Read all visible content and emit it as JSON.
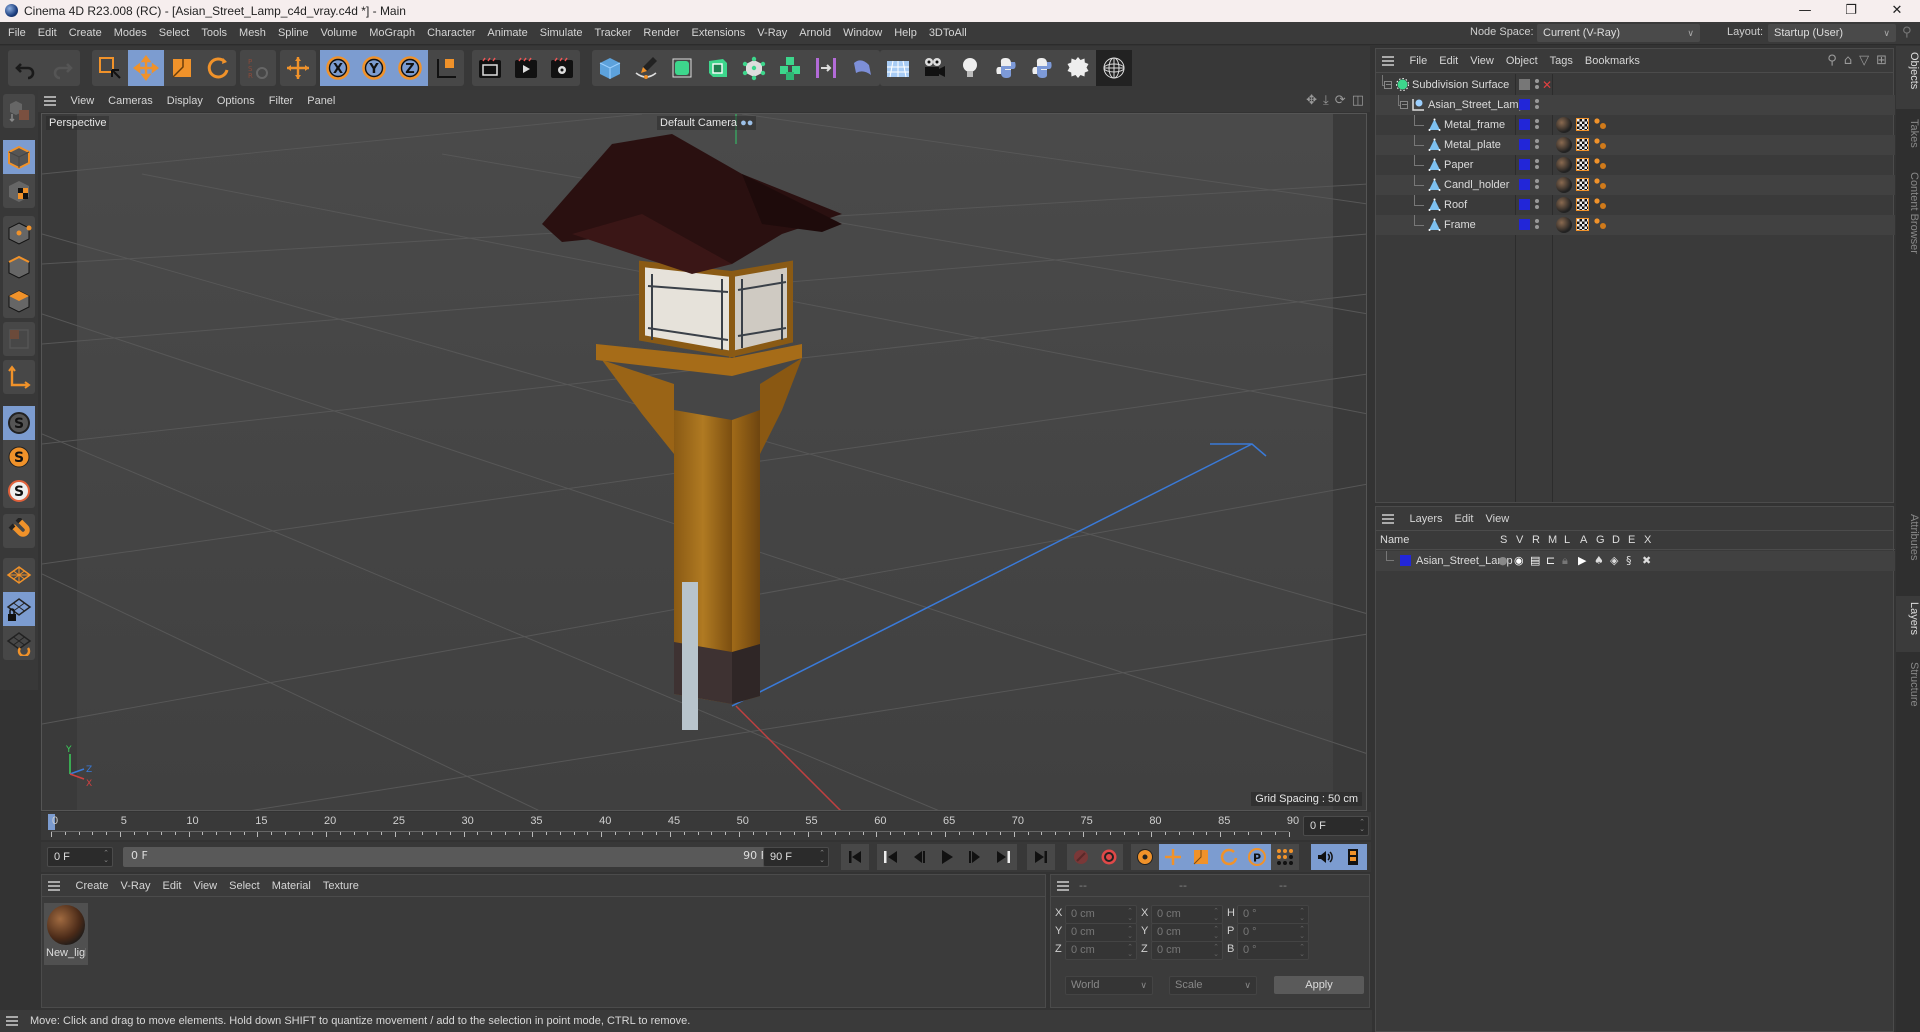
{
  "window": {
    "title": "Cinema 4D R23.008 (RC) - [Asian_Street_Lamp_c4d_vray.c4d *] - Main",
    "controls": [
      "minimize",
      "maximize",
      "close"
    ]
  },
  "menubar": {
    "items": [
      "File",
      "Edit",
      "Create",
      "Modes",
      "Select",
      "Tools",
      "Mesh",
      "Spline",
      "Volume",
      "MoGraph",
      "Character",
      "Animate",
      "Simulate",
      "Tracker",
      "Render",
      "Extensions",
      "V-Ray",
      "Arnold",
      "Window",
      "Help",
      "3DToAll"
    ],
    "node_space_label": "Node Space:",
    "node_space_value": "Current (V-Ray)",
    "layout_label": "Layout:",
    "layout_value": "Startup (User)"
  },
  "toolbar": {
    "groups": [
      [
        "undo-icon",
        "redo-icon"
      ],
      [
        "live-selection-icon",
        "move-icon",
        "scale-icon",
        "rotate-icon"
      ],
      [
        "psr-icon"
      ],
      [
        "world-axis-move-icon"
      ],
      [
        "x-axis-lock-icon",
        "y-axis-lock-icon",
        "z-axis-lock-icon",
        "coordinate-system-icon"
      ],
      [
        "render-view-icon",
        "render-picture-viewer-icon",
        "render-settings-icon"
      ],
      [
        "cube-icon",
        "pen-icon",
        "subdivision-icon",
        "extrude-icon",
        "cloner-icon",
        "mograph-array-icon",
        "symmetry-icon",
        "deformer-bend-icon"
      ],
      [
        "floor-icon",
        "camera-icon",
        "light-icon",
        "python-icon",
        "python-script-icon",
        "gear-badge-icon",
        "sphere-wire-icon"
      ]
    ],
    "active": [
      "move-icon",
      "x-axis-lock-icon",
      "y-axis-lock-icon",
      "z-axis-lock-icon"
    ]
  },
  "left_tools": {
    "items": [
      "make-editable-icon",
      "model-mode-icon",
      "texture-mode-icon",
      "point-mode-icon",
      "edge-mode-icon",
      "polygon-mode-icon",
      "uv-mode-icon",
      "axis-mode-icon",
      "solo-off-icon",
      "solo-single-icon",
      "solo-hierarchy-icon",
      "snap-icon",
      "workplane-icon",
      "workplane-lock-icon",
      "workplane-align-icon"
    ],
    "active": [
      "model-mode-icon",
      "solo-off-icon",
      "workplane-lock-icon"
    ]
  },
  "viewport": {
    "menu": [
      "View",
      "Cameras",
      "Display",
      "Options",
      "Filter",
      "Panel"
    ],
    "view_name": "Perspective",
    "camera_name": "Default Camera",
    "grid_spacing": "Grid Spacing : 50 cm",
    "nav_icons": [
      "move-view-icon",
      "zoom-view-icon",
      "rotate-view-icon",
      "maximize-view-icon"
    ],
    "axis_labels": {
      "x": "X",
      "y": "Y",
      "z": "Z"
    }
  },
  "timeline": {
    "labels": [
      0,
      5,
      10,
      15,
      20,
      25,
      30,
      35,
      40,
      45,
      50,
      55,
      60,
      65,
      70,
      75,
      80,
      85,
      90
    ],
    "current_frame_display": "0 F",
    "start_field": "0 F",
    "range_start": "0 F",
    "range_end": "90 F",
    "end_field": "90 F",
    "playhead_frame": 0,
    "max_frame": 90
  },
  "playback": {
    "buttons": [
      "go-to-start-icon",
      "previous-key-icon",
      "previous-frame-icon",
      "play-icon",
      "next-frame-icon",
      "next-key-icon",
      "go-to-end-icon",
      "record-disabled-icon",
      "autokey-icon",
      "keyframe-settings-icon",
      "key-position-icon",
      "key-scale-icon",
      "key-rotation-icon",
      "key-parameter-icon",
      "key-pla-icon",
      "sound-icon",
      "timeline-film-icon"
    ],
    "active": [
      "key-position-icon",
      "key-scale-icon",
      "key-rotation-icon",
      "key-parameter-icon",
      "sound-icon",
      "timeline-film-icon"
    ]
  },
  "material_manager": {
    "menu": [
      "Create",
      "V-Ray",
      "Edit",
      "View",
      "Select",
      "Material",
      "Texture"
    ],
    "materials": [
      {
        "name": "New_ligl"
      }
    ]
  },
  "coordinates": {
    "headers": [
      "--",
      "--",
      "--"
    ],
    "rows": [
      {
        "a": "X",
        "a_val": "0 cm",
        "b": "X",
        "b_val": "0 cm",
        "c": "H",
        "c_val": "0 °"
      },
      {
        "a": "Y",
        "a_val": "0 cm",
        "b": "Y",
        "b_val": "0 cm",
        "c": "P",
        "c_val": "0 °"
      },
      {
        "a": "Z",
        "a_val": "0 cm",
        "b": "Z",
        "b_val": "0 cm",
        "c": "B",
        "c_val": "0 °"
      }
    ],
    "space": "World",
    "mode": "Scale",
    "apply_label": "Apply"
  },
  "status": {
    "text": "Move: Click and drag to move elements. Hold down SHIFT to quantize movement / add to the selection in point mode, CTRL to remove."
  },
  "object_manager": {
    "menu": [
      "File",
      "Edit",
      "View",
      "Object",
      "Tags",
      "Bookmarks"
    ],
    "tools": [
      "search-icon",
      "home-icon",
      "filter-icon",
      "new-window-icon"
    ],
    "objects": [
      {
        "name": "Subdivision Surface",
        "level": 0,
        "type": "subdivision",
        "color": "#2226d8",
        "tags": false
      },
      {
        "name": "Asian_Street_Lamp",
        "level": 1,
        "type": "null",
        "color": "#2226d8",
        "tags": false
      },
      {
        "name": "Metal_frame",
        "level": 2,
        "type": "polygon",
        "color": "#2226d8",
        "tags": true
      },
      {
        "name": "Metal_plate",
        "level": 2,
        "type": "polygon",
        "color": "#2226d8",
        "tags": true
      },
      {
        "name": "Paper",
        "level": 2,
        "type": "polygon",
        "color": "#2226d8",
        "tags": true
      },
      {
        "name": "Candl_holder",
        "level": 2,
        "type": "polygon",
        "color": "#2226d8",
        "tags": true
      },
      {
        "name": "Roof",
        "level": 2,
        "type": "polygon",
        "color": "#2226d8",
        "tags": true
      },
      {
        "name": "Frame",
        "level": 2,
        "type": "polygon",
        "color": "#2226d8",
        "tags": true
      }
    ]
  },
  "layer_manager": {
    "menu": [
      "Layers",
      "Edit",
      "View"
    ],
    "columns": [
      "Name",
      "S",
      "V",
      "R",
      "M",
      "L",
      "A",
      "G",
      "D",
      "E",
      "X"
    ],
    "layers": [
      {
        "name": "Asian_Street_Lamp",
        "color": "#2226d8"
      }
    ]
  },
  "side_tabs": {
    "top": [
      "Objects",
      "Takes",
      "Content Browser"
    ],
    "bottom": [
      "Attributes",
      "Layers",
      "Structure"
    ],
    "active": [
      "Objects",
      "Layers"
    ]
  },
  "colors": {
    "accent_blue": "#7c9cd0",
    "orange": "#f0922a",
    "layer_blue": "#2226d8"
  }
}
